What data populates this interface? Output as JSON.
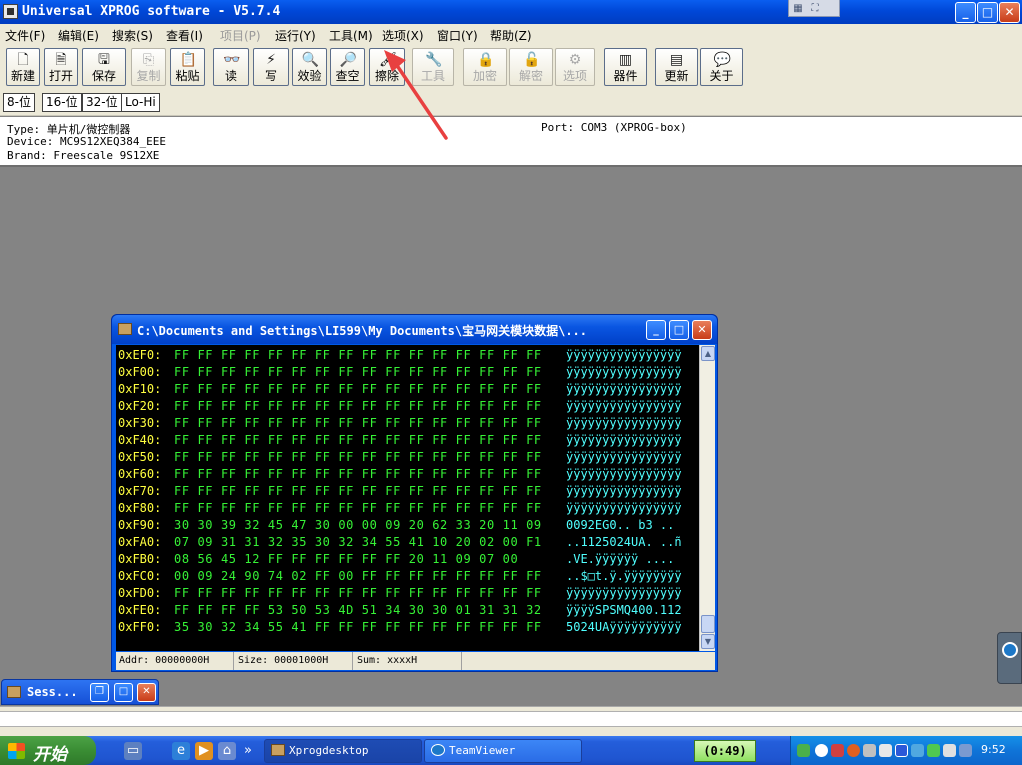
{
  "window": {
    "title": "Universal XPROG software - V5.7.4",
    "min_glyph": "_",
    "max_glyph": "□",
    "close_glyph": "✕",
    "ts_glyphs": [
      "▦",
      "⛶",
      "⌄"
    ]
  },
  "menu": [
    {
      "label": "文件(F)",
      "disabled": false
    },
    {
      "label": "编辑(E)",
      "disabled": false
    },
    {
      "label": "搜索(S)",
      "disabled": false
    },
    {
      "label": "查看(I)",
      "disabled": false
    },
    {
      "label": "项目(P)",
      "disabled": true
    },
    {
      "label": "运行(Y)",
      "disabled": false
    },
    {
      "label": "工具(M)",
      "disabled": false
    },
    {
      "label": "选项(X)",
      "disabled": false
    },
    {
      "label": "窗口(Y)",
      "disabled": false
    },
    {
      "label": "帮助(Z)",
      "disabled": false
    }
  ],
  "toolbar": [
    {
      "label": "新建",
      "icon": "new-file-icon",
      "glyph": "🗋",
      "disabled": false
    },
    {
      "label": "打开",
      "icon": "open-file-icon",
      "glyph": "🗎",
      "disabled": false
    },
    {
      "label": "保存",
      "icon": "save-icon",
      "glyph": "🖫",
      "disabled": false
    },
    {
      "label": "复制",
      "icon": "copy-icon",
      "glyph": "⎘",
      "disabled": true
    },
    {
      "label": "粘贴",
      "icon": "paste-icon",
      "glyph": "📋",
      "disabled": false
    },
    {
      "label": "读",
      "icon": "read-icon",
      "glyph": "👓",
      "disabled": false
    },
    {
      "label": "写",
      "icon": "write-icon",
      "glyph": "⚡",
      "disabled": false
    },
    {
      "label": "效验",
      "icon": "verify-icon",
      "glyph": "🔍",
      "disabled": false
    },
    {
      "label": "查空",
      "icon": "blank-check-icon",
      "glyph": "🔎",
      "disabled": false
    },
    {
      "label": "擦除",
      "icon": "erase-icon",
      "glyph": "🖌",
      "disabled": false
    },
    {
      "label": "工具",
      "icon": "tools-icon",
      "glyph": "🔧",
      "disabled": true
    },
    {
      "label": "加密",
      "icon": "lock-icon",
      "glyph": "🔒",
      "disabled": true
    },
    {
      "label": "解密",
      "icon": "unlock-icon",
      "glyph": "🔓",
      "disabled": true
    },
    {
      "label": "选项",
      "icon": "options-icon",
      "glyph": "⚙",
      "disabled": true
    },
    {
      "label": "器件",
      "icon": "chip-icon",
      "glyph": "▥",
      "disabled": false
    },
    {
      "label": "更新",
      "icon": "update-icon",
      "glyph": "▤",
      "disabled": false
    },
    {
      "label": "关于",
      "icon": "about-icon",
      "glyph": "💬",
      "disabled": false
    }
  ],
  "bit_buttons": [
    "8-位",
    "16-位",
    "32-位",
    "Lo-Hi"
  ],
  "info": {
    "type": "Type: 单片机/微控制器",
    "device": "Device: MC9S12XEQ384_EEE",
    "brand": "Brand: Freescale 9S12XE",
    "port": "Port: COM3 (XPROG-box)"
  },
  "hex_window": {
    "title": "C:\\Documents and Settings\\LI599\\My Documents\\宝马网关模块数据\\...",
    "rows": [
      {
        "addr": "0xEF0:",
        "bytes": "FF FF FF FF FF FF FF FF FF FF FF FF FF FF FF FF",
        "ascii": "ÿÿÿÿÿÿÿÿÿÿÿÿÿÿÿÿ"
      },
      {
        "addr": "0xF00:",
        "bytes": "FF FF FF FF FF FF FF FF FF FF FF FF FF FF FF FF",
        "ascii": "ÿÿÿÿÿÿÿÿÿÿÿÿÿÿÿÿ"
      },
      {
        "addr": "0xF10:",
        "bytes": "FF FF FF FF FF FF FF FF FF FF FF FF FF FF FF FF",
        "ascii": "ÿÿÿÿÿÿÿÿÿÿÿÿÿÿÿÿ"
      },
      {
        "addr": "0xF20:",
        "bytes": "FF FF FF FF FF FF FF FF FF FF FF FF FF FF FF FF",
        "ascii": "ÿÿÿÿÿÿÿÿÿÿÿÿÿÿÿÿ"
      },
      {
        "addr": "0xF30:",
        "bytes": "FF FF FF FF FF FF FF FF FF FF FF FF FF FF FF FF",
        "ascii": "ÿÿÿÿÿÿÿÿÿÿÿÿÿÿÿÿ"
      },
      {
        "addr": "0xF40:",
        "bytes": "FF FF FF FF FF FF FF FF FF FF FF FF FF FF FF FF",
        "ascii": "ÿÿÿÿÿÿÿÿÿÿÿÿÿÿÿÿ"
      },
      {
        "addr": "0xF50:",
        "bytes": "FF FF FF FF FF FF FF FF FF FF FF FF FF FF FF FF",
        "ascii": "ÿÿÿÿÿÿÿÿÿÿÿÿÿÿÿÿ"
      },
      {
        "addr": "0xF60:",
        "bytes": "FF FF FF FF FF FF FF FF FF FF FF FF FF FF FF FF",
        "ascii": "ÿÿÿÿÿÿÿÿÿÿÿÿÿÿÿÿ"
      },
      {
        "addr": "0xF70:",
        "bytes": "FF FF FF FF FF FF FF FF FF FF FF FF FF FF FF FF",
        "ascii": "ÿÿÿÿÿÿÿÿÿÿÿÿÿÿÿÿ"
      },
      {
        "addr": "0xF80:",
        "bytes": "FF FF FF FF FF FF FF FF FF FF FF FF FF FF FF FF",
        "ascii": "ÿÿÿÿÿÿÿÿÿÿÿÿÿÿÿÿ"
      },
      {
        "addr": "0xF90:",
        "bytes": "30 30 39 32 45 47 30 00 00 09 20 62 33 20 11 09",
        "ascii": "0092EG0.. b3 .."
      },
      {
        "addr": "0xFA0:",
        "bytes": "07 09 31 31 32 35 30 32 34 55 41 10 20 02 00 F1",
        "ascii": "..1125024UA. ..ñ"
      },
      {
        "addr": "0xFB0:",
        "bytes": "08 56 45 12 FF FF FF FF FF FF 20 11 09 07 00",
        "ascii": ".VE.ÿÿÿÿÿÿ ...."
      },
      {
        "addr": "0xFC0:",
        "bytes": "00 09 24 90 74 02 FF 00 FF FF FF FF FF FF FF FF",
        "ascii": "..$□t.ÿ.ÿÿÿÿÿÿÿÿ"
      },
      {
        "addr": "0xFD0:",
        "bytes": "FF FF FF FF FF FF FF FF FF FF FF FF FF FF FF FF",
        "ascii": "ÿÿÿÿÿÿÿÿÿÿÿÿÿÿÿÿ"
      },
      {
        "addr": "0xFE0:",
        "bytes": "FF FF FF FF 53 50 53 4D 51 34 30 30 01 31 31 32",
        "ascii": "ÿÿÿÿSPSMQ400.112"
      },
      {
        "addr": "0xFF0:",
        "bytes": "35 30 32 34 55 41 FF FF FF FF FF FF FF FF FF FF",
        "ascii": "5024UAÿÿÿÿÿÿÿÿÿÿ"
      }
    ],
    "status": {
      "addr": "Addr: 00000000H",
      "size": "Size: 00001000H",
      "sum": "Sum: xxxxH"
    }
  },
  "session": {
    "title": "Sess..."
  },
  "taskbar": {
    "start": "开始",
    "tasks": [
      {
        "label": "Xprogdesktop",
        "active": true
      },
      {
        "label": "TeamViewer",
        "active": false
      }
    ],
    "timer": "(0:49)",
    "clock": "9:52",
    "more_glyph": "»"
  },
  "colors": {
    "hex_addr": "#ffff40",
    "hex_bytes": "#36f236",
    "hex_ascii": "#50ffff",
    "annotation_arrow": "#e84040"
  }
}
